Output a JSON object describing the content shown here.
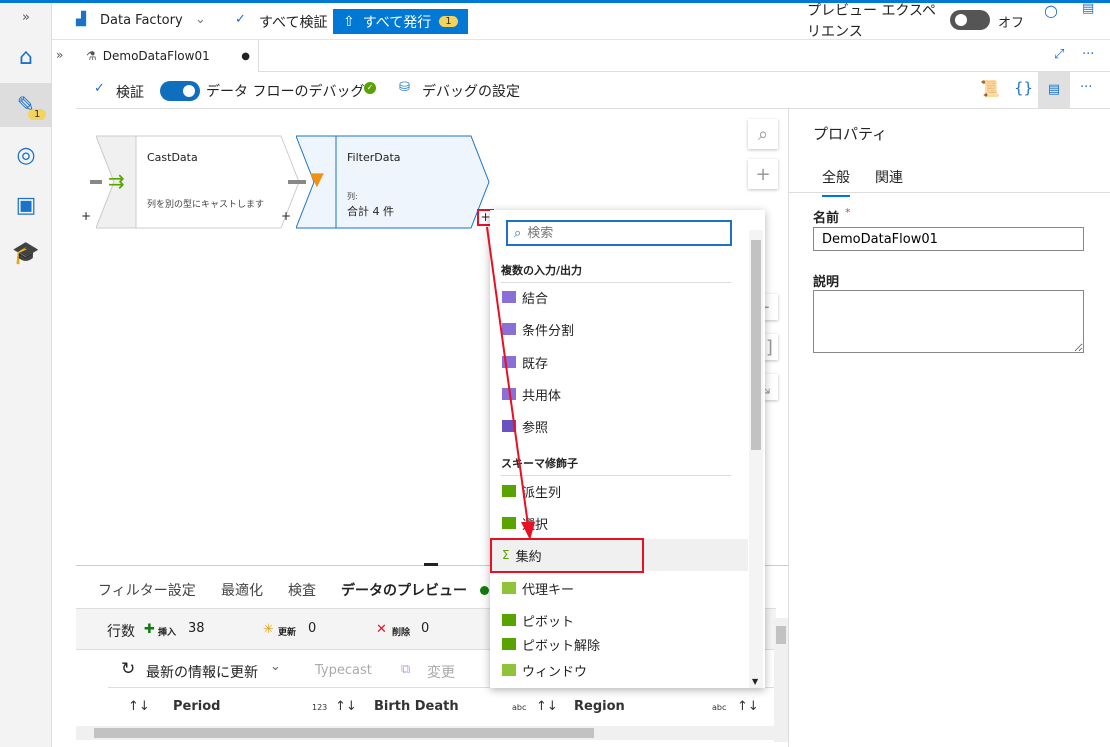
{
  "topbar": {
    "expand": "»",
    "factory": "Data Factory",
    "validate_all": "すべて検証",
    "publish_all": "すべて発行",
    "publish_count": "1",
    "preview_experience": "プレビュー エクスペリエンス",
    "preview_toggle": "オフ"
  },
  "rail": {
    "author_badge": "1"
  },
  "tab": {
    "expand": "»",
    "name": "DemoDataFlow01",
    "dirty": "●"
  },
  "toolbar": {
    "validate": "検証",
    "debug": "データ フローのデバッグ",
    "debug_settings": "デバッグの設定",
    "more": "···"
  },
  "canvas": {
    "nodes": [
      {
        "name": "CastData",
        "desc": "列を別の型にキャストします"
      },
      {
        "name": "FilterData",
        "cols_label": "列:",
        "cols_value": "合計 4 件"
      }
    ],
    "plus": "+"
  },
  "menu": {
    "search_placeholder": "検索",
    "sections": [
      {
        "title": "複数の入力/出力",
        "items": [
          "結合",
          "条件分割",
          "既存",
          "共用体",
          "参照"
        ]
      },
      {
        "title": "スキーマ修飾子",
        "items": [
          "派生列",
          "選択",
          "集約",
          "代理キー",
          "ピボット",
          "ピボット解除",
          "ウィンドウ"
        ]
      }
    ],
    "highlighted": "集約"
  },
  "properties": {
    "title": "プロパティ",
    "tabs": [
      "全般",
      "関連"
    ],
    "name_label": "名前",
    "required": "*",
    "name_value": "DemoDataFlow01",
    "desc_label": "説明",
    "desc_value": ""
  },
  "bottom": {
    "tabs": [
      "フィルター設定",
      "最適化",
      "検査",
      "データのプレビュー"
    ],
    "rows_label": "行数",
    "insert_label": "挿入",
    "insert": "38",
    "update_label": "更新",
    "update": "0",
    "delete_label": "削除",
    "delete": "0",
    "refresh": "最新の情報に更新",
    "typecast": "Typecast",
    "modify": "変更",
    "columns": [
      {
        "name": "Period",
        "type": "123"
      },
      {
        "name": "Birth Death",
        "type": "abc"
      },
      {
        "name": "Region",
        "type": "abc"
      }
    ],
    "sort": "↑↓"
  },
  "colors": {
    "accent": "#0078d4",
    "highlight": "#e81123"
  }
}
